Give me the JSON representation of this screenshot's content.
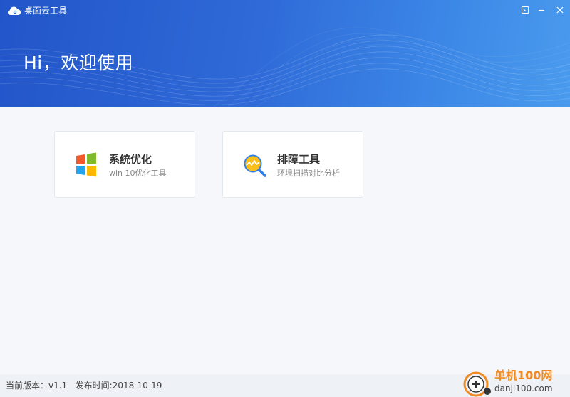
{
  "app": {
    "title": "桌面云工具"
  },
  "header": {
    "greeting": "Hi，欢迎使用"
  },
  "window_controls": [
    "feedback-icon",
    "minimize-icon",
    "close-icon"
  ],
  "cards": [
    {
      "title": "系统优化",
      "desc": "win 10优化工具",
      "icon": "windows-logo-icon"
    },
    {
      "title": "排障工具",
      "desc": "环境扫描对比分析",
      "icon": "diagnostic-magnifier-icon"
    }
  ],
  "footer": {
    "version": "当前版本：v1.1",
    "release": "发布时间:2018-10-19"
  },
  "watermark": {
    "name": "单机100网",
    "domain": "danji100.com"
  },
  "colors": {
    "header_start": "#2255c9",
    "header_end": "#4a9bee",
    "win_red": "#f25a2b",
    "win_green": "#7fba2b",
    "win_blue": "#22a4ee",
    "win_yellow": "#fdb900",
    "diag_yellow": "#fbbf1c",
    "diag_blue": "#2d7fe8",
    "watermark_orange": "#f08a24"
  }
}
